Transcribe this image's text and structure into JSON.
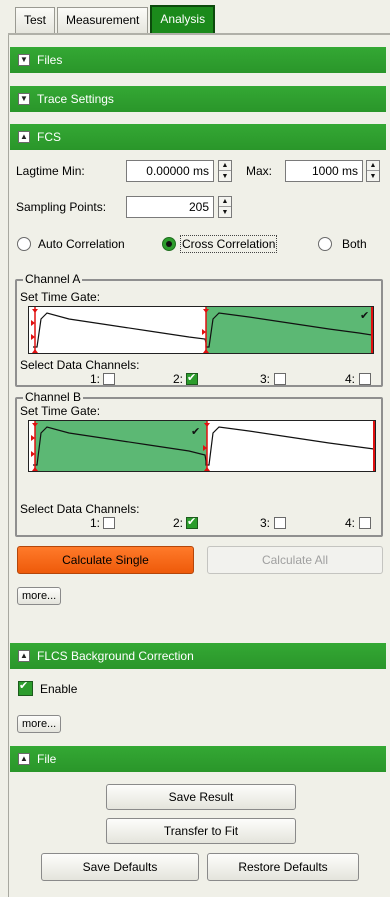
{
  "tabs": [
    {
      "label": "Test"
    },
    {
      "label": "Measurement"
    },
    {
      "label": "Analysis"
    }
  ],
  "sections": {
    "files": "Files",
    "trace_settings": "Trace Settings",
    "fcs": "FCS",
    "flcs": "FLCS Background Correction",
    "file": "File"
  },
  "fcs": {
    "lagtime_label": "Lagtime  Min:",
    "lagtime_min": "0.00000 ms",
    "max_label": "Max:",
    "lagtime_max": "1000 ms",
    "sampling_label": "Sampling Points:",
    "sampling_points": "205",
    "modes": [
      "Auto Correlation",
      "Cross Correlation",
      "Both"
    ],
    "selected_mode": "Cross Correlation",
    "channel_a": {
      "title": "Channel A",
      "time_gate_label": "Set Time Gate:",
      "data_channels_label": "Select Data Channels:",
      "channels": [
        "1:",
        "2:",
        "3:",
        "4:"
      ],
      "checked": [
        false,
        true,
        false,
        false
      ]
    },
    "channel_b": {
      "title": "Channel B",
      "time_gate_label": "Set Time Gate:",
      "data_channels_label": "Select Data Channels:",
      "channels": [
        "1:",
        "2:",
        "3:",
        "4:"
      ],
      "checked": [
        false,
        true,
        false,
        false
      ]
    },
    "calculate_single": "Calculate Single",
    "calculate_all": "Calculate All",
    "more": "more..."
  },
  "flcs": {
    "enable_label": "Enable",
    "enabled": true,
    "more": "more..."
  },
  "file": {
    "save_result": "Save Result",
    "transfer_to_fit": "Transfer to Fit",
    "save_defaults": "Save Defaults",
    "restore_defaults": "Restore Defaults"
  },
  "colors": {
    "section_green": "#2e9e2e",
    "gate_fill": "#5cb874",
    "accent_orange": "#f06418",
    "marker_red": "#e01010"
  }
}
